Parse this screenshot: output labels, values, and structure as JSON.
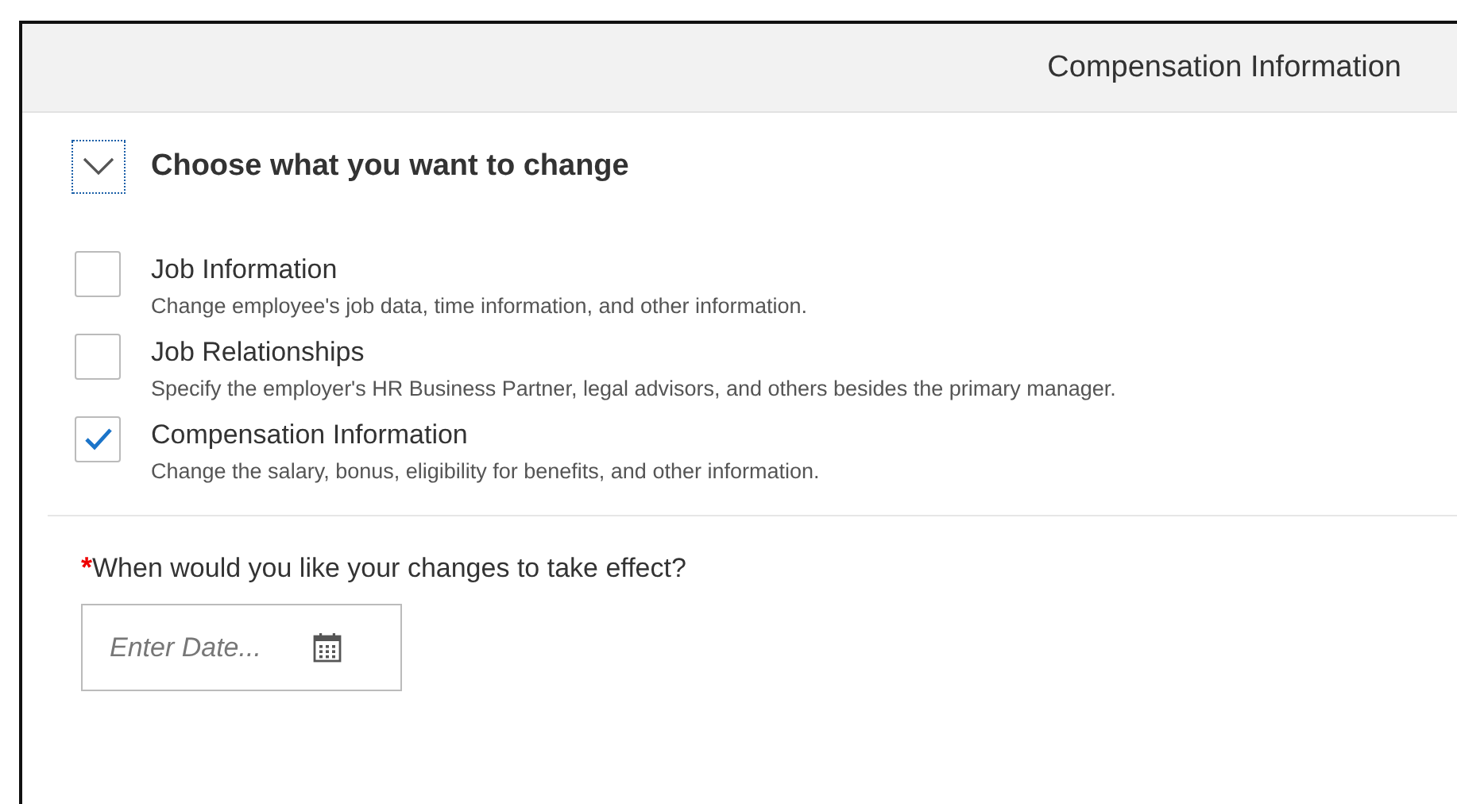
{
  "header": {
    "title": "Compensation Information"
  },
  "section": {
    "title": "Choose what you want to change",
    "expanded": true,
    "options": [
      {
        "label": "Job Information",
        "description": "Change employee's job data, time information, and other information.",
        "checked": false
      },
      {
        "label": "Job Relationships",
        "description": "Specify the employer's HR Business Partner, legal advisors, and others besides the primary manager.",
        "checked": false
      },
      {
        "label": "Compensation Information",
        "description": "Change the salary, bonus, eligibility for benefits, and other information.",
        "checked": true
      }
    ]
  },
  "date_field": {
    "label": "When would you like your changes to take effect?",
    "required_mark": "*",
    "placeholder": "Enter Date..."
  }
}
